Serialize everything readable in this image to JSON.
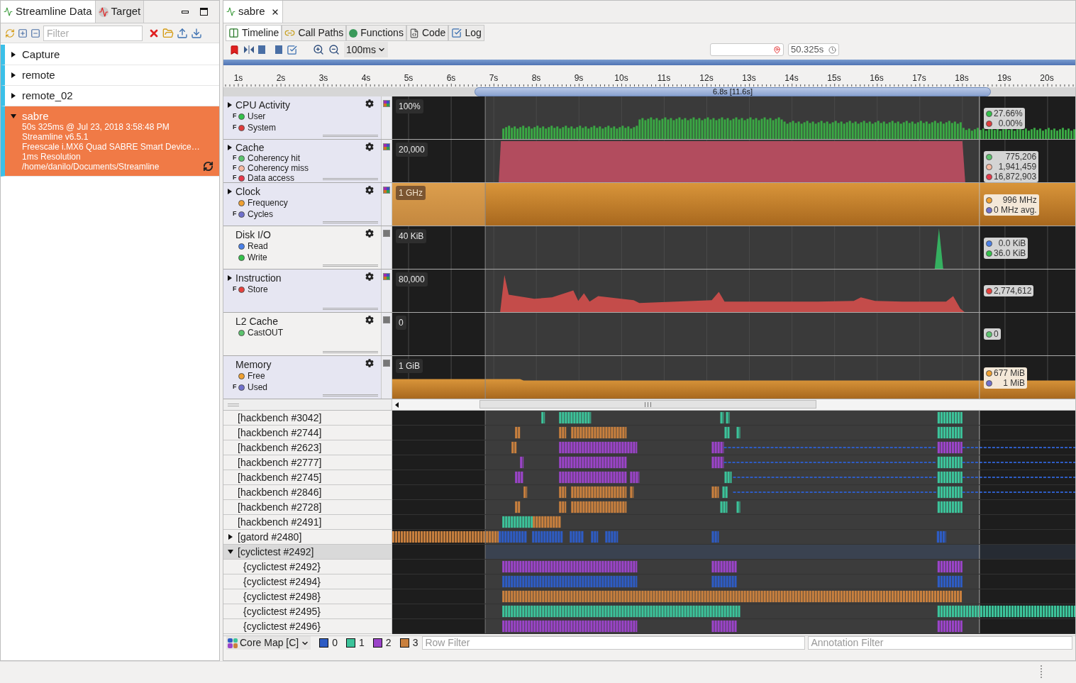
{
  "left_panel": {
    "tabs": [
      {
        "label": "Streamline Data",
        "selected": true
      },
      {
        "label": "Target",
        "selected": false
      }
    ],
    "filter": {
      "placeholder": "Filter"
    },
    "captures": [
      {
        "name": "Capture",
        "expanded": false,
        "selected": false
      },
      {
        "name": "remote",
        "expanded": false,
        "selected": false
      },
      {
        "name": "remote_02",
        "expanded": false,
        "selected": false
      },
      {
        "name": "sabre",
        "expanded": true,
        "selected": true,
        "details": [
          "50s 325ms @ Jul 23, 2018 3:58:48 PM",
          "Streamline v6.5.1",
          "Freescale i.MX6 Quad SABRE Smart Device…",
          "1ms Resolution",
          "/home/danilo/Documents/Streamline"
        ]
      }
    ]
  },
  "editor": {
    "tab": "sabre",
    "view_tabs": [
      {
        "label": "Timeline",
        "selected": true
      },
      {
        "label": "Call Paths",
        "selected": false
      },
      {
        "label": "Functions",
        "selected": false
      },
      {
        "label": "Code",
        "selected": false
      },
      {
        "label": "Log",
        "selected": false
      }
    ],
    "zoom": "100ms",
    "time": "50.325s",
    "ruler": {
      "ticks": [
        "1s",
        "2s",
        "3s",
        "4s",
        "5s",
        "6s",
        "7s",
        "8s",
        "9s",
        "10s",
        "11s",
        "12s",
        "13s",
        "14s",
        "15s",
        "16s",
        "17s",
        "18s",
        "19s",
        "20s"
      ],
      "range": "6.8s [11.6s]"
    },
    "charts": [
      {
        "title": "CPU Activity",
        "kind": "bars",
        "expandable": true,
        "shaded": true,
        "scale": "100%",
        "series": [
          {
            "name": "User",
            "flag": "F",
            "color": "#33c24a"
          },
          {
            "name": "System",
            "flag": "F",
            "color": "#e03c3c"
          }
        ],
        "values": [
          {
            "text": "27.66%",
            "color": "#33c24a"
          },
          {
            "text": "0.00%",
            "color": "#e03c3c"
          }
        ]
      },
      {
        "title": "Cache",
        "kind": "block",
        "expandable": true,
        "shaded": true,
        "scale": "20,000",
        "series": [
          {
            "name": "Coherency hit",
            "flag": "F",
            "color": "#5cc46e"
          },
          {
            "name": "Coherency miss",
            "flag": "F",
            "color": "#f7b8a0"
          },
          {
            "name": "Data access",
            "flag": "F",
            "color": "#e8384a"
          }
        ],
        "values": [
          {
            "text": "775,206",
            "color": "#5cc46e"
          },
          {
            "text": "1,941,459",
            "color": "#f7b8a0"
          },
          {
            "text": "16,872,903",
            "color": "#e8384a"
          }
        ]
      },
      {
        "title": "Clock",
        "kind": "fill",
        "expandable": true,
        "shaded": true,
        "scale": "1 GHz",
        "series": [
          {
            "name": "Frequency",
            "color": "#f0a030"
          },
          {
            "name": "Cycles",
            "flag": "F",
            "color": "#7070cc"
          }
        ],
        "values": [
          {
            "text": "996 MHz",
            "color": "#f0a030"
          },
          {
            "text": "0 MHz avg.",
            "color": "#7070cc"
          }
        ]
      },
      {
        "title": "Disk I/O",
        "kind": "spike",
        "expandable": false,
        "shaded": false,
        "scale": "40 KiB",
        "series": [
          {
            "name": "Read",
            "color": "#4a80e8"
          },
          {
            "name": "Write",
            "color": "#33c24a"
          }
        ],
        "values": [
          {
            "text": "0.0 KiB",
            "color": "#4a80e8"
          },
          {
            "text": "36.0 KiB",
            "color": "#33c24a"
          }
        ]
      },
      {
        "title": "Instruction",
        "kind": "wave",
        "expandable": true,
        "shaded": true,
        "scale": "80,000",
        "series": [
          {
            "name": "Store",
            "flag": "F",
            "color": "#e8403c"
          }
        ],
        "values": [
          {
            "text": "2,774,612",
            "color": "#e8403c"
          }
        ]
      },
      {
        "title": "L2 Cache",
        "kind": "empty",
        "expandable": false,
        "shaded": false,
        "scale": "0",
        "series": [
          {
            "name": "CastOUT",
            "color": "#5cc46e"
          }
        ],
        "values": [
          {
            "text": "0",
            "color": "#5cc46e"
          }
        ]
      },
      {
        "title": "Memory",
        "kind": "base",
        "expandable": false,
        "shaded": true,
        "scale": "1 GiB",
        "series": [
          {
            "name": "Free",
            "color": "#f0a030"
          },
          {
            "name": "Used",
            "flag": "F",
            "color": "#7070cc"
          }
        ],
        "values": [
          {
            "text": "677 MiB",
            "color": "#f0a030"
          },
          {
            "text": "1 MiB",
            "color": "#7070cc"
          }
        ]
      }
    ],
    "processes": [
      {
        "name": "[hackbench #3042]",
        "selected": false
      },
      {
        "name": "[hackbench #2744]",
        "selected": false
      },
      {
        "name": "[hackbench #2623]",
        "selected": false
      },
      {
        "name": "[hackbench #2777]",
        "selected": false
      },
      {
        "name": "[hackbench #2745]",
        "selected": false
      },
      {
        "name": "[hackbench #2846]",
        "selected": false
      },
      {
        "name": "[hackbench #2728]",
        "selected": false
      },
      {
        "name": "[hackbench #2491]",
        "selected": false
      },
      {
        "name": "[gatord #2480]",
        "selected": false,
        "expanded": false
      },
      {
        "name": "[cyclictest #2492]",
        "selected": true,
        "expanded": true,
        "children": [
          {
            "name": "{cyclictest #2492}",
            "selected": false
          },
          {
            "name": "{cyclictest #2494}",
            "selected": false
          },
          {
            "name": "{cyclictest #2498}",
            "selected": false
          },
          {
            "name": "{cyclictest #2495}",
            "selected": false
          },
          {
            "name": "{cyclictest #2496}",
            "selected": false
          }
        ]
      }
    ],
    "core_map": {
      "label": "Core Map [C]",
      "cores": [
        {
          "label": "0",
          "color": "#2e5cc4"
        },
        {
          "label": "1",
          "color": "#3cc39a"
        },
        {
          "label": "2",
          "color": "#9b44c9"
        },
        {
          "label": "3",
          "color": "#c9803e"
        }
      ]
    },
    "row_filter": {
      "placeholder": "Row Filter"
    },
    "annotation_filter": {
      "placeholder": "Annotation Filter"
    }
  }
}
